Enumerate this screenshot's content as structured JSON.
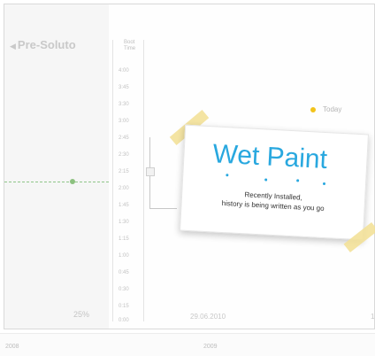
{
  "panel": {
    "title": "Pre-Soluto",
    "percent": "25%"
  },
  "axis": {
    "head_line1": "Boot",
    "head_line2": "Time",
    "ticks": [
      "4:00",
      "3:45",
      "3:30",
      "3:00",
      "2:45",
      "2:30",
      "2:15",
      "2:00",
      "1:45",
      "1:30",
      "1:15",
      "1:00",
      "0:45",
      "0:30",
      "0:15",
      "0:00"
    ]
  },
  "timeline": {
    "date": "29.06.2010",
    "edge_label": "1"
  },
  "legend": {
    "today_label": "Today",
    "today_color": "#f2c31a"
  },
  "note": {
    "title": "Wet Paint",
    "line1": "Recently Installed,",
    "line2": "history is being written as you go",
    "title_color": "#29a8df"
  },
  "footer": {
    "year_left": "2008",
    "year_right": "2009"
  }
}
